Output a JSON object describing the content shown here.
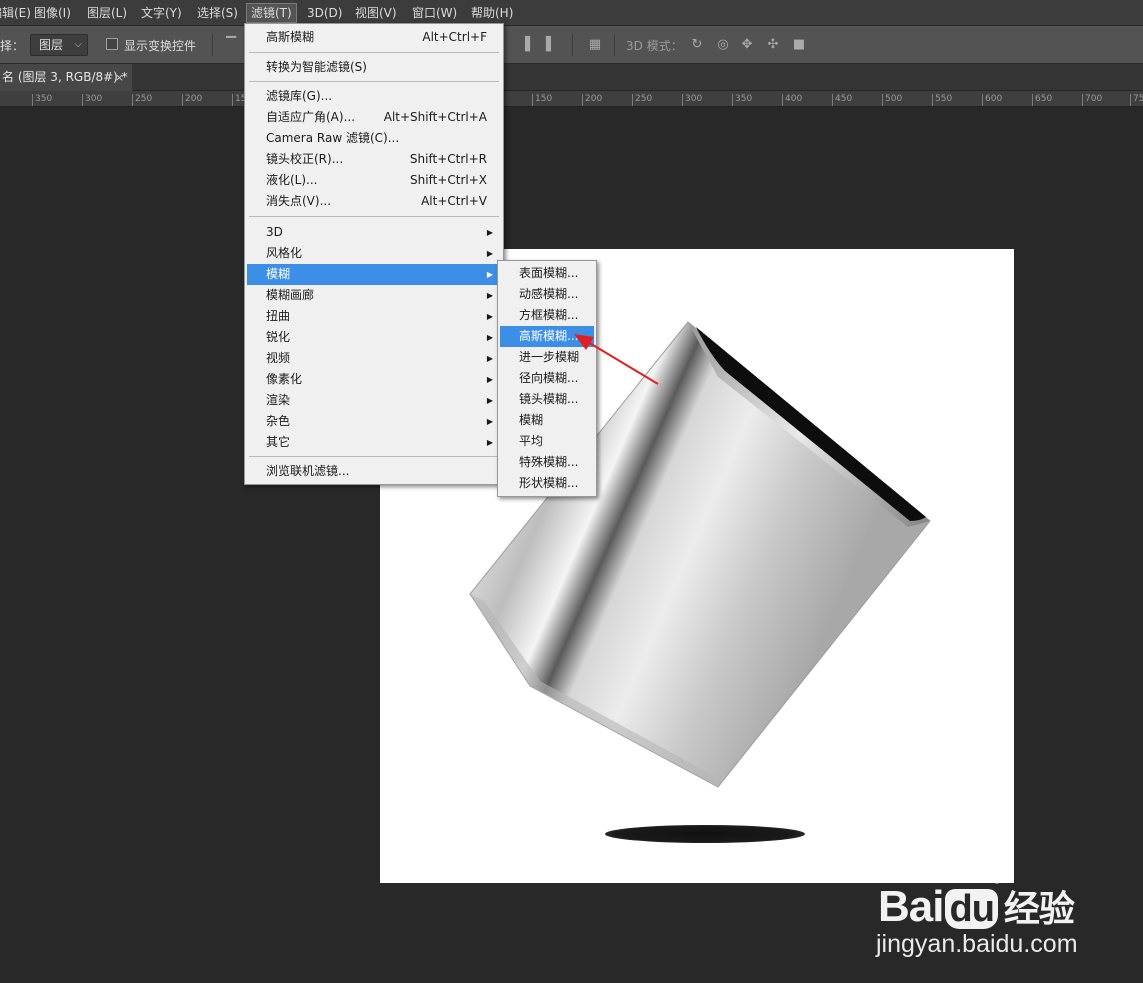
{
  "menubar": {
    "items": [
      "编辑(E)",
      "图像(I)",
      "图层(L)",
      "文字(Y)",
      "选择(S)",
      "滤镜(T)",
      "3D(D)",
      "视图(V)",
      "窗口(W)",
      "帮助(H)"
    ],
    "active_index": 5
  },
  "options": {
    "select_label": "选择：",
    "select_value": "图层",
    "show_transform_label": "显示变换控件",
    "mode_3d_label": "3D 模式："
  },
  "document": {
    "tab_title": "名 (图层 3, RGB/8#) *",
    "close_glyph": "×",
    "ruler_ticks": [
      "350",
      "300",
      "250",
      "200",
      "15",
      "150",
      "200",
      "250",
      "300",
      "350",
      "400",
      "450",
      "500",
      "550",
      "600",
      "650",
      "700",
      "75"
    ]
  },
  "filter_menu": {
    "items": [
      {
        "label": "高斯模糊",
        "shortcut": "Alt+Ctrl+F"
      },
      {
        "label": "转换为智能滤镜(S)",
        "shortcut": ""
      },
      {
        "label": "滤镜库(G)...",
        "shortcut": ""
      },
      {
        "label": "自适应广角(A)...",
        "shortcut": "Alt+Shift+Ctrl+A"
      },
      {
        "label": "Camera Raw 滤镜(C)...",
        "shortcut": ""
      },
      {
        "label": "镜头校正(R)...",
        "shortcut": "Shift+Ctrl+R"
      },
      {
        "label": "液化(L)...",
        "shortcut": "Shift+Ctrl+X"
      },
      {
        "label": "消失点(V)...",
        "shortcut": "Alt+Ctrl+V"
      },
      {
        "label": "3D",
        "shortcut": ""
      },
      {
        "label": "风格化",
        "shortcut": ""
      },
      {
        "label": "模糊",
        "shortcut": ""
      },
      {
        "label": "模糊画廊",
        "shortcut": ""
      },
      {
        "label": "扭曲",
        "shortcut": ""
      },
      {
        "label": "锐化",
        "shortcut": ""
      },
      {
        "label": "视频",
        "shortcut": ""
      },
      {
        "label": "像素化",
        "shortcut": ""
      },
      {
        "label": "渲染",
        "shortcut": ""
      },
      {
        "label": "杂色",
        "shortcut": ""
      },
      {
        "label": "其它",
        "shortcut": ""
      },
      {
        "label": "浏览联机滤镜...",
        "shortcut": ""
      }
    ],
    "highlighted_index": 10
  },
  "blur_submenu": {
    "items": [
      "表面模糊...",
      "动感模糊...",
      "方框模糊...",
      "高斯模糊...",
      "进一步模糊",
      "径向模糊...",
      "镜头模糊...",
      "模糊",
      "平均",
      "特殊模糊...",
      "形状模糊..."
    ],
    "highlighted_index": 3
  },
  "watermark": {
    "brand": "Bai",
    "brand_suffix": "du",
    "service": "经验",
    "url": "jingyan.baidu.com"
  },
  "colors": {
    "highlight": "#3d8ee6",
    "annotation_arrow": "#e02020",
    "menu_bg": "#f0f0f0",
    "workspace": "#282828"
  }
}
